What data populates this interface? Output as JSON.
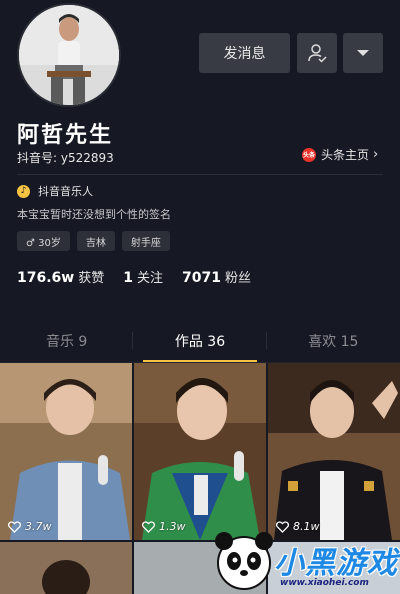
{
  "profile": {
    "name": "阿哲先生",
    "douyin_id": "抖音号: y522893",
    "toutiao_label": "头条主页",
    "toutiao_badge": "头条",
    "musician_label": "抖音音乐人",
    "bio": "本宝宝暂时还没想到个性的签名",
    "tags": [
      "♂ 30岁",
      "吉林",
      "射手座"
    ],
    "stats": {
      "likes_num": "176.6w",
      "likes_label": "获赞",
      "following_num": "1",
      "following_label": "关注",
      "followers_num": "7071",
      "followers_label": "粉丝"
    }
  },
  "actions": {
    "message_label": "发消息",
    "follow_icon": "user-check-icon",
    "more_icon": "caret-down-icon"
  },
  "tabs": [
    {
      "label": "音乐 9",
      "active": false
    },
    {
      "label": "作品 36",
      "active": true
    },
    {
      "label": "喜欢 15",
      "active": false
    }
  ],
  "videos": [
    {
      "likes": "3.7w"
    },
    {
      "likes": "1.3w"
    },
    {
      "likes": "8.1w"
    }
  ],
  "watermark": {
    "title": "小黑游戏",
    "url": "www.xiaohei.com"
  },
  "colors": {
    "background": "#161823",
    "button": "#393b44",
    "accent": "#f6c244",
    "toutiao_red": "#e8342b"
  }
}
